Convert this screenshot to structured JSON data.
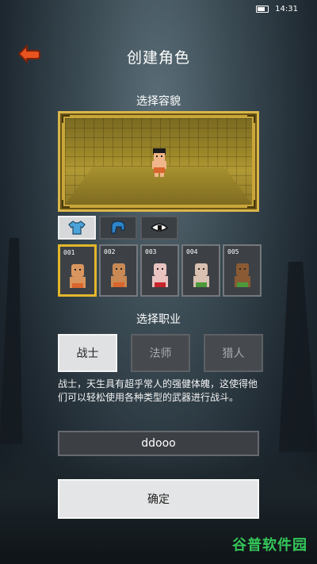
{
  "status_bar": {
    "time": "14:31"
  },
  "header": {
    "title": "创建角色"
  },
  "appearance": {
    "label": "选择容貌",
    "tabs": [
      {
        "icon": "shirt-icon"
      },
      {
        "icon": "hair-icon"
      },
      {
        "icon": "eye-icon"
      }
    ],
    "skins": [
      {
        "num": "001",
        "color": "#d9955e",
        "selected": true
      },
      {
        "num": "002",
        "color": "#c98954"
      },
      {
        "num": "003",
        "color": "#e9c3c0"
      },
      {
        "num": "004",
        "color": "#d9c0b0"
      },
      {
        "num": "005",
        "color": "#8a5a34"
      }
    ]
  },
  "profession": {
    "label": "选择职业",
    "classes": [
      {
        "label": "战士",
        "active": true
      },
      {
        "label": "法师",
        "active": false
      },
      {
        "label": "猎人",
        "active": false
      }
    ],
    "description": "战士，天生具有超乎常人的强健体魄，这使得他们可以轻松使用各种类型的武器进行战斗。"
  },
  "name_field": {
    "value": "ddooo"
  },
  "confirm": {
    "label": "确定"
  },
  "watermark": "谷普软件园"
}
